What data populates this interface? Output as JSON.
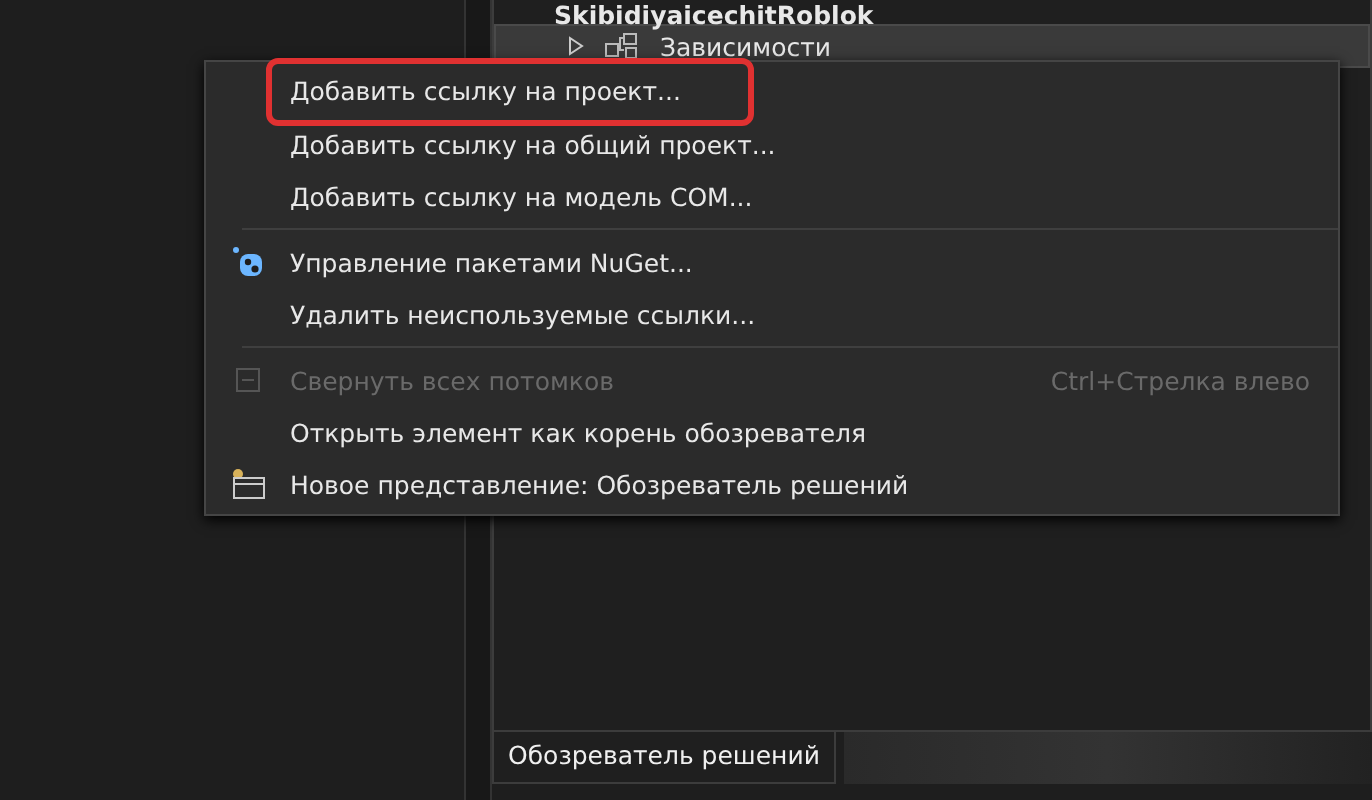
{
  "tree": {
    "project": "SkibidiyaicechitRoblok",
    "items": [
      {
        "label": "Зависимости",
        "expanded": false,
        "selected": true
      }
    ]
  },
  "context_menu": {
    "groups": [
      [
        {
          "label": "Добавить ссылку на проект...",
          "highlighted": true,
          "disabled": false,
          "kind": "plain"
        },
        {
          "label": "Добавить ссылку на общий проект...",
          "highlighted": false,
          "disabled": false,
          "kind": "plain"
        },
        {
          "label": "Добавить ссылку на модель COM...",
          "highlighted": false,
          "disabled": false,
          "kind": "plain"
        }
      ],
      [
        {
          "label": "Управление пакетами NuGet...",
          "highlighted": false,
          "disabled": false,
          "kind": "nuget"
        },
        {
          "label": "Удалить неиспользуемые ссылки...",
          "highlighted": false,
          "disabled": false,
          "kind": "plain"
        }
      ],
      [
        {
          "label": "Свернуть всех потомков",
          "shortcut": "Ctrl+Стрелка влево",
          "highlighted": false,
          "disabled": true,
          "kind": "collapse"
        },
        {
          "label": "Открыть элемент как корень обозревателя",
          "highlighted": false,
          "disabled": false,
          "kind": "plain"
        },
        {
          "label": "Новое представление: Обозреватель решений",
          "highlighted": false,
          "disabled": false,
          "kind": "newview"
        }
      ]
    ]
  },
  "tabs": [
    {
      "label": "Обозреватель решений",
      "selected": true
    }
  ]
}
